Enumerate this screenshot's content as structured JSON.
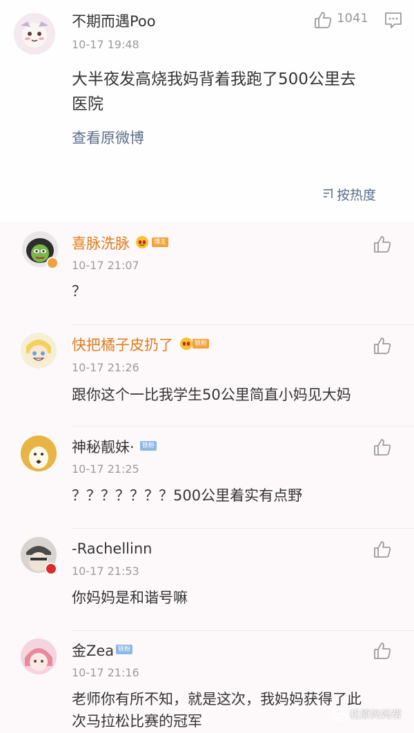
{
  "post": {
    "author": "不期而遇Poo",
    "time": "10-17 19:48",
    "like_count": "1041",
    "content_line1": "大半夜发高烧我妈背着我跑了500公里去",
    "content_line2": "医院",
    "view_original": "查看原微博",
    "sort_label": "按热度"
  },
  "comments": [
    {
      "name": "喜脉洗脉",
      "time": "10-17 21:07",
      "text": "？",
      "badge": "博主"
    },
    {
      "name": "快把橘子皮扔了",
      "time": "10-17 21:26",
      "text": "跟你这个一比我学生50公里简直小妈见大妈",
      "badge": "铁粉"
    },
    {
      "name": "神秘靓妹·",
      "time": "10-17 21:25",
      "text": "？？？？？？？500公里着实有点野",
      "badge": "铁粉"
    },
    {
      "name": "-Rachellinn",
      "time": "10-17 21:53",
      "text": "你妈妈是和谐号嘛"
    },
    {
      "name": "金Zea",
      "time": "10-17 21:16",
      "text_line1": "老师你有所不知，就是这次，我妈妈获得了此",
      "text_line2": "次马拉松比赛的冠军",
      "badge": "铁粉"
    }
  ],
  "watermark": "松原妈妈帮",
  "colors": {
    "name_orange": "#e27b1a",
    "link_blue": "#5b6f89",
    "badge_orange": "#f3a23b",
    "badge_blue": "#8fb7e4"
  }
}
